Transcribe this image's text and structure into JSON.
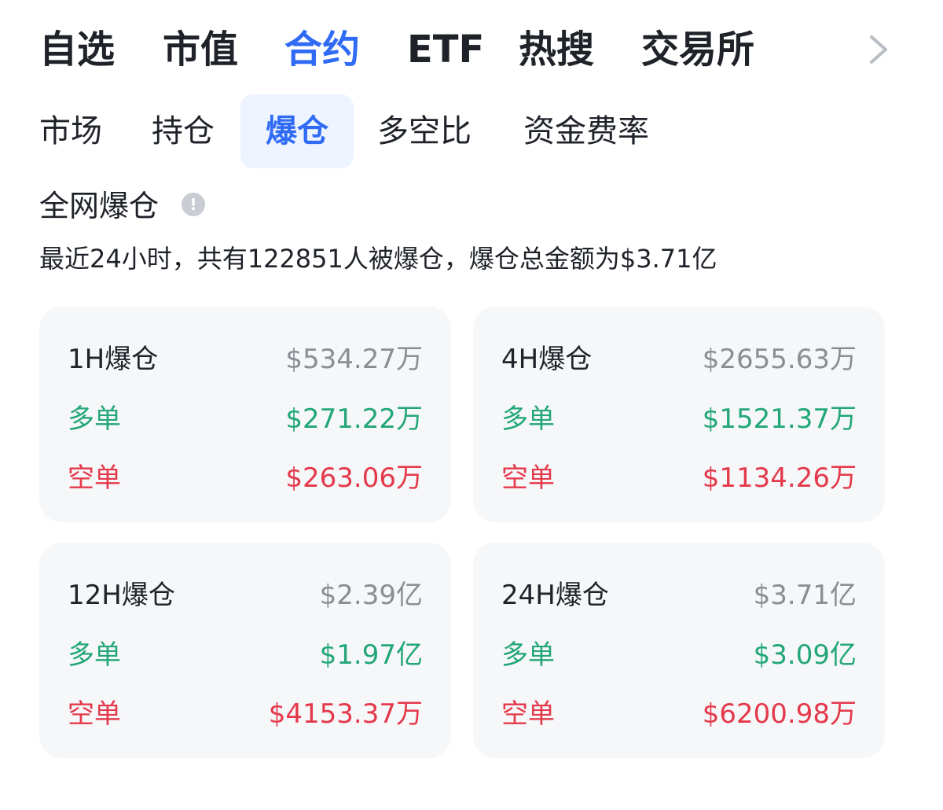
{
  "top_tabs": [
    "自选",
    "市值",
    "合约",
    "ETF",
    "热搜",
    "交易所"
  ],
  "active_top_tab": "合约",
  "sub_tabs": [
    "市场",
    "持仓",
    "爆仓",
    "多空比",
    "资金费率"
  ],
  "active_sub_tab": "爆仓",
  "section": {
    "title": "全网爆仓",
    "info_icon": "!",
    "summary": "最近24小时，共有122851人被爆仓，爆仓总金额为$3.71亿"
  },
  "cards": [
    {
      "title": "1H爆仓",
      "total": "$534.27万",
      "long_label": "多单",
      "long_value": "$271.22万",
      "short_label": "空单",
      "short_value": "$263.06万"
    },
    {
      "title": "4H爆仓",
      "total": "$2655.63万",
      "long_label": "多单",
      "long_value": "$1521.37万",
      "short_label": "空单",
      "short_value": "$1134.26万"
    },
    {
      "title": "12H爆仓",
      "total": "$2.39亿",
      "long_label": "多单",
      "long_value": "$1.97亿",
      "short_label": "空单",
      "short_value": "$4153.37万"
    },
    {
      "title": "24H爆仓",
      "total": "$3.71亿",
      "long_label": "多单",
      "long_value": "$3.09亿",
      "short_label": "空单",
      "short_value": "$6200.98万"
    }
  ],
  "colors": {
    "accent": "#2f6bf5",
    "accent_bg": "#edf3ff",
    "long": "#22a67a",
    "short": "#e4394b",
    "muted": "#8a8d94",
    "card_bg": "#f6f7f9"
  }
}
